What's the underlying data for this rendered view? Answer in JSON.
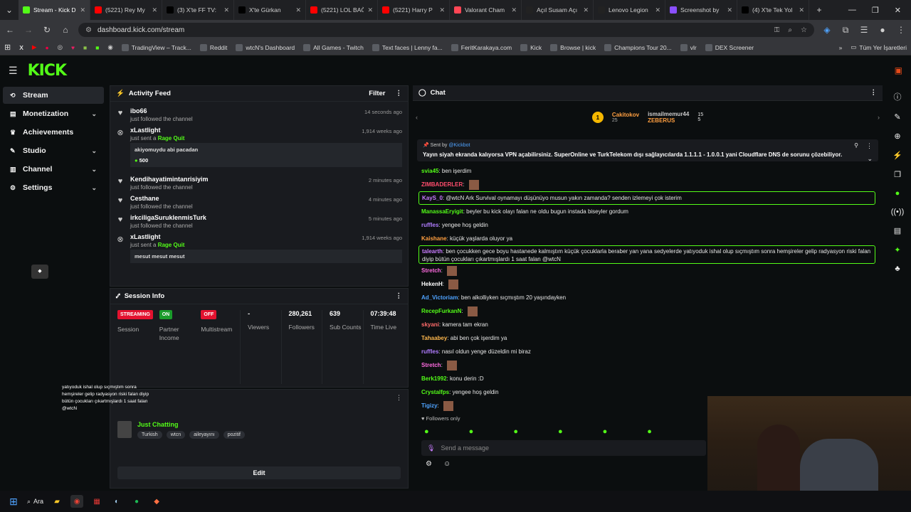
{
  "browser": {
    "tabs": [
      {
        "title": "Stream - Kick D",
        "color": "#53fc18",
        "active": true
      },
      {
        "title": "(5221) Rey My",
        "color": "#ff0000"
      },
      {
        "title": "(3) X'te FF TV:",
        "color": "#000000"
      },
      {
        "title": "X'te Gürkan",
        "color": "#000000"
      },
      {
        "title": "(5221) LOL BAĞ",
        "color": "#ff0000"
      },
      {
        "title": "(5221) Harry P",
        "color": "#ff0000"
      },
      {
        "title": "Valorant Cham",
        "color": "#ff4655"
      },
      {
        "title": "Açıl Susam Açı",
        "color": "#222222"
      },
      {
        "title": "Lenovo Legion",
        "color": "#222222"
      },
      {
        "title": "Screenshot by",
        "color": "#8a4fff"
      },
      {
        "title": "(4) X'te Tek Yol",
        "color": "#000000"
      }
    ],
    "url": "dashboard.kick.com/stream",
    "bookmarks": [
      "TradingView – Track...",
      "Reddit",
      "wtcN's Dashboard",
      "All Games - Twitch",
      "Text faces | Lenny fa...",
      "FeritKarakaya.com",
      "Kick",
      "Browse | kick",
      "Champions Tour 20...",
      "vlr",
      "DEX Screener"
    ],
    "all_bookmarks": "Tüm Yer İşaretleri"
  },
  "app": {
    "logo": "KICK"
  },
  "sidebar": {
    "items": [
      {
        "label": "Stream",
        "active": true,
        "chevron": false
      },
      {
        "label": "Monetization",
        "chevron": true
      },
      {
        "label": "Achievements",
        "chevron": false
      },
      {
        "label": "Studio",
        "chevron": true
      },
      {
        "label": "Channel",
        "chevron": true
      },
      {
        "label": "Settings",
        "chevron": true
      }
    ]
  },
  "activity": {
    "title": "Activity Feed",
    "filter": "Filter",
    "items": [
      {
        "name": "ibo66",
        "sub": "just followed the channel",
        "ts": "14 seconds ago",
        "icon": "heart"
      },
      {
        "name": "xLastlight",
        "sub": "just sent a ",
        "sub_hl": "Rage Quit",
        "ts": "1,914 weeks ago",
        "icon": "x",
        "msg": "akiyomuydu abi pacadan",
        "amount": "500"
      },
      {
        "name": "Kendihayatimintanrisiyim",
        "sub": "just followed the channel",
        "ts": "2 minutes ago",
        "icon": "heart"
      },
      {
        "name": "Cesthane",
        "sub": "just followed the channel",
        "ts": "4 minutes ago",
        "icon": "heart"
      },
      {
        "name": "irkciligaSuruklenmisTurk",
        "sub": "just followed the channel",
        "ts": "5 minutes ago",
        "icon": "heart"
      },
      {
        "name": "xLastlight",
        "sub": "just sent a ",
        "sub_hl": "Rage Quit",
        "ts": "1,914 weeks ago",
        "icon": "x",
        "msg": "mesut mesut mesut"
      }
    ]
  },
  "session": {
    "title": "Session Info",
    "badges": [
      {
        "text": "STREAMING",
        "color": "#e3122f",
        "label": "Session"
      },
      {
        "text": "ON",
        "color": "#1a9c2b",
        "label": "Partner Income"
      },
      {
        "text": "OFF",
        "color": "#e3122f",
        "label": "Multistream"
      }
    ],
    "stats": [
      {
        "value": "-",
        "label": "Viewers"
      },
      {
        "value": "280,261",
        "label": "Followers"
      },
      {
        "value": "639",
        "label": "Sub Counts"
      },
      {
        "value": "07:39:48",
        "label": "Time Live"
      }
    ]
  },
  "streaminfo": {
    "category": "Just Chatting",
    "tags": [
      "Turkish",
      "wtcn",
      "aileyayını",
      "pozitif"
    ],
    "edit": "Edit"
  },
  "chat": {
    "title": "Chat",
    "top_users": [
      {
        "name": "Cakitokov",
        "count": "25"
      },
      {
        "name": "ismailmemur44",
        "count": "15"
      },
      {
        "name": "ZEBERUS",
        "count": "5"
      }
    ],
    "pinned_by": "Sent by",
    "pinned_user": "@Kickbot",
    "pinned_msg": "Yayın siyah ekranda kalıyorsa VPN açabilirsiniz. SuperOnline ve TurkTelekom dışı sağlayıcılarda 1.1.1.1 - 1.0.0.1 yani Cloudflare DNS de sorunu çözebiliyor.",
    "messages": [
      {
        "user": "svia45",
        "color": "#53fc18",
        "text": "ben işerdim"
      },
      {
        "user": "ZIMBADERLER",
        "color": "#ff4d6d",
        "text": ""
      },
      {
        "user": "KayS_0",
        "color": "#c97cff",
        "text": "@wtcN Ark Survival oynamayı düşünüyo musun yakın zamanda? senden izlemeyi çok isterim",
        "highlight": true
      },
      {
        "user": "ManassaEryigit",
        "color": "#53fc18",
        "text": "beyler bu kick olayı falan ne oldu bugun instada biseyler gordum"
      },
      {
        "user": "ruffles",
        "color": "#b07cff",
        "text": "yengee hoş geldin"
      },
      {
        "user": "Kaishane",
        "color": "#ff9f40",
        "text": "küçük yaşlarda oluyor ya"
      },
      {
        "user": "talearth",
        "color": "#c97cff",
        "text": "ben çocukken gece boyu hastanede kalmıştım küçük çocuklarla beraber yan yana sedyelerde yatıyoduk ishal olup sıçmıştım sonra hemşireler gelip radyasyon riski falan diyip bütün çocukları çıkartmışlardı 1 saat falan @wtcN",
        "highlight": true
      },
      {
        "user": "Stretch",
        "color": "#ff6be0",
        "text": ""
      },
      {
        "user": "HekenH",
        "color": "#ffffff",
        "text": ""
      },
      {
        "user": "Ad_Victoriam",
        "color": "#4fa3ff",
        "text": "ben alkolliyken sıçmıştım 20 yaşındayken"
      },
      {
        "user": "RecepFurkanN",
        "color": "#53fc18",
        "text": ""
      },
      {
        "user": "skyani",
        "color": "#ff6b6b",
        "text": "kamera tam ekran"
      },
      {
        "user": "Tahaabey",
        "color": "#ffb84d",
        "text": "abi ben çok işerdim ya"
      },
      {
        "user": "ruffles",
        "color": "#b07cff",
        "text": "nasıl oldun yenge düzeldin mi biraz"
      },
      {
        "user": "Stretch",
        "color": "#ff6be0",
        "text": ""
      },
      {
        "user": "Berk1992",
        "color": "#53fc18",
        "text": "konu derin :D"
      },
      {
        "user": "Crystalfps",
        "color": "#53fc18",
        "text": "yengee hoş geldin"
      },
      {
        "user": "Tigizy",
        "color": "#4fa3ff",
        "text": ""
      }
    ],
    "followers_only": "Followers only",
    "placeholder": "Send a message"
  },
  "taskbar": {
    "search": "Ara"
  },
  "overlay": [
    "yatıyoduk ishal olup sıçmıştım sonra",
    "hemşireler gelip radyasyon riski falan diyip",
    "bütün çocukları çıkartmışlardı 1 saat falan",
    "@wtcN"
  ],
  "colors": {
    "accent": "#53fc18",
    "panel": "#191b1f",
    "bg": "#0b0e0f"
  }
}
